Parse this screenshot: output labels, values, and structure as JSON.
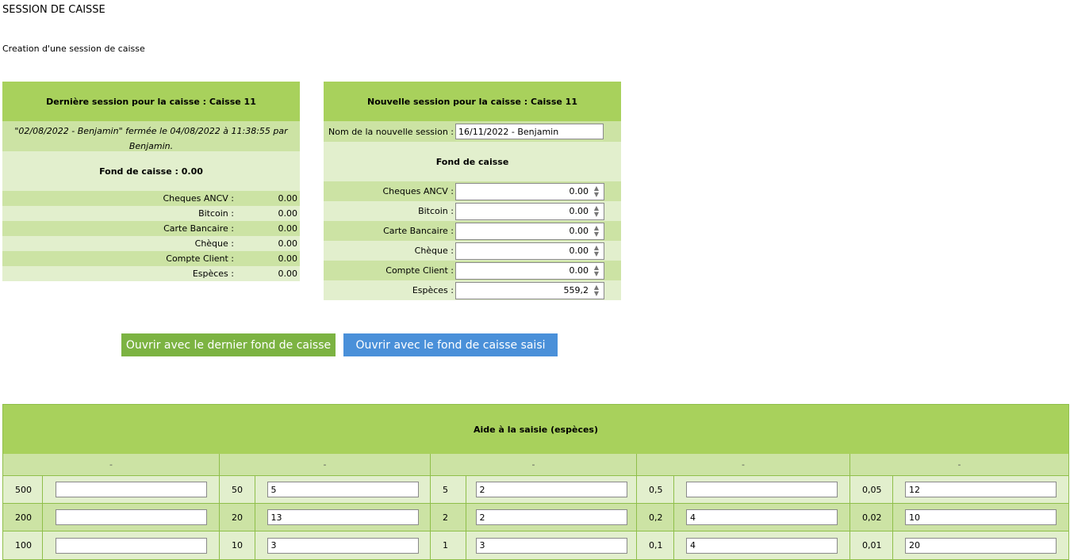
{
  "page": {
    "title": "SESSION DE CAISSE",
    "subtitle": "Creation d'une session de caisse"
  },
  "last_session": {
    "header": "Dernière session pour la caisse : Caisse 11",
    "note": "\"02/08/2022 - Benjamin\" fermée le 04/08/2022 à 11:38:55 par Benjamin.",
    "fund_label": "Fond de caisse : 0.00",
    "rows": [
      {
        "label": "Cheques ANCV :",
        "value": "0.00"
      },
      {
        "label": "Bitcoin :",
        "value": "0.00"
      },
      {
        "label": "Carte Bancaire :",
        "value": "0.00"
      },
      {
        "label": "Chèque :",
        "value": "0.00"
      },
      {
        "label": "Compte Client :",
        "value": "0.00"
      },
      {
        "label": "Espèces :",
        "value": "0.00"
      }
    ]
  },
  "new_session": {
    "header": "Nouvelle session pour la caisse : Caisse 11",
    "name_label": "Nom de la nouvelle session :",
    "name_value": "16/11/2022 - Benjamin",
    "fund_label": "Fond de caisse",
    "rows": [
      {
        "label": "Cheques ANCV :",
        "value": "0.00"
      },
      {
        "label": "Bitcoin :",
        "value": "0.00"
      },
      {
        "label": "Carte Bancaire :",
        "value": "0.00"
      },
      {
        "label": "Chèque :",
        "value": "0.00"
      },
      {
        "label": "Compte Client :",
        "value": "0.00"
      },
      {
        "label": "Espèces :",
        "value": "559,2"
      }
    ]
  },
  "buttons": {
    "open_last": "Ouvrir avec le dernier fond de caisse",
    "open_entered": "Ouvrir avec le fond de caisse saisi"
  },
  "colors": {
    "header_green": "#a8d15c",
    "row_green_dark": "#cce3a4",
    "row_green_light": "#e2efcd",
    "button_green": "#7cb342",
    "button_blue": "#4a90d9"
  },
  "cash_helper": {
    "title": "Aide à la saisie (espèces)",
    "columns": [
      {
        "header": "-",
        "rows": [
          {
            "denom": "500",
            "qty": ""
          },
          {
            "denom": "200",
            "qty": ""
          },
          {
            "denom": "100",
            "qty": ""
          }
        ]
      },
      {
        "header": "-",
        "rows": [
          {
            "denom": "50",
            "qty": "5"
          },
          {
            "denom": "20",
            "qty": "13"
          },
          {
            "denom": "10",
            "qty": "3"
          }
        ]
      },
      {
        "header": "-",
        "rows": [
          {
            "denom": "5",
            "qty": "2"
          },
          {
            "denom": "2",
            "qty": "2"
          },
          {
            "denom": "1",
            "qty": "3"
          }
        ]
      },
      {
        "header": "-",
        "rows": [
          {
            "denom": "0,5",
            "qty": ""
          },
          {
            "denom": "0,2",
            "qty": "4"
          },
          {
            "denom": "0,1",
            "qty": "4"
          }
        ]
      },
      {
        "header": "-",
        "rows": [
          {
            "denom": "0,05",
            "qty": "12"
          },
          {
            "denom": "0,02",
            "qty": "10"
          },
          {
            "denom": "0,01",
            "qty": "20"
          }
        ]
      }
    ]
  }
}
